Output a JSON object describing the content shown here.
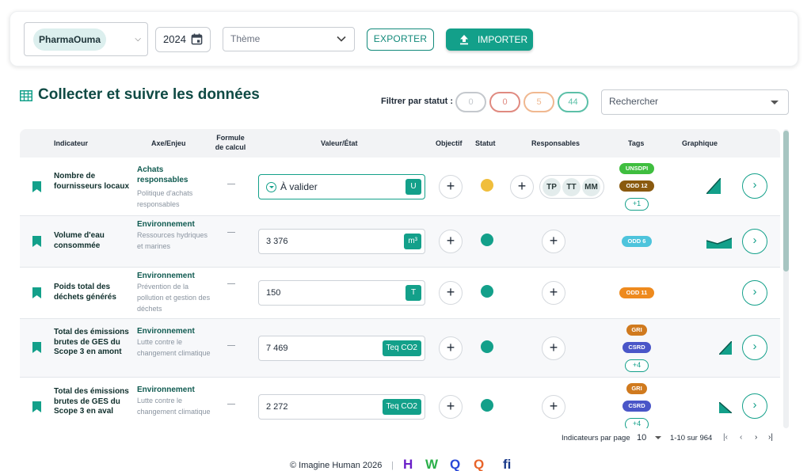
{
  "toolbar": {
    "company": "PharmaOuma",
    "year": "2024",
    "theme_placeholder": "Thème",
    "export_label": "EXPORTER",
    "import_label": "IMPORTER"
  },
  "header": {
    "title": "Collecter et suivre les données",
    "filter_label": "Filtrer par statut :",
    "status_counts": [
      {
        "value": "0",
        "color": "#c4c8cd"
      },
      {
        "value": "0",
        "color": "#e08a80"
      },
      {
        "value": "5",
        "color": "#f0b890"
      },
      {
        "value": "44",
        "color": "#5cc0a8"
      }
    ],
    "search_placeholder": "Rechercher"
  },
  "table": {
    "columns": {
      "indicator": "Indicateur",
      "axe": "Axe/Enjeu",
      "formula_line1": "Formule",
      "formula_line2": "de calcul",
      "value": "Valeur/État",
      "objective": "Objectif",
      "status": "Statut",
      "responsables": "Responsables",
      "tags": "Tags",
      "graph": "Graphique"
    },
    "rows": [
      {
        "name": "Nombre de fournisseurs locaux",
        "axe": "Achats responsables",
        "enjeu": "Politique d'achats responsables",
        "value": "À valider",
        "unit": "U",
        "status_color": "#f0be3c",
        "responsables": [
          "TP",
          "TT",
          "MM"
        ],
        "tags": [
          {
            "label": "UNSDPI",
            "color": "#3fbe3f"
          },
          {
            "label": "ODD 12",
            "color": "#8a5a0f"
          }
        ],
        "more_tags": "+1",
        "graph": "rising"
      },
      {
        "name": "Volume d'eau consommée",
        "axe": "Environnement",
        "enjeu": "Ressources hydriques et marines",
        "value": "3 376",
        "unit": "m³",
        "status_color": "#13a08a",
        "responsables": [],
        "tags": [
          {
            "label": "ODD 6",
            "color": "#4ec4dc"
          }
        ],
        "more_tags": "",
        "graph": "flat-rising"
      },
      {
        "name": "Poids total des déchets générés",
        "axe": "Environnement",
        "enjeu": "Prévention de la pollution et gestion des déchets",
        "value": "150",
        "unit": "T",
        "status_color": "#13a08a",
        "responsables": [],
        "tags": [
          {
            "label": "ODD 11",
            "color": "#ee8a1e"
          }
        ],
        "more_tags": "",
        "graph": "none"
      },
      {
        "name": "Total des émissions brutes de GES du Scope 3 en amont",
        "axe": "Environnement",
        "enjeu": "Lutte contre le changement climatique",
        "value": "7 469",
        "unit": "Teq CO2",
        "status_color": "#13a08a",
        "responsables": [],
        "tags": [
          {
            "label": "GRI",
            "color": "#d07a1e"
          },
          {
            "label": "CSRD",
            "color": "#4a56c8"
          }
        ],
        "more_tags": "+4",
        "graph": "rising"
      },
      {
        "name": "Total des émissions brutes de GES du Scope 3 en aval",
        "axe": "Environnement",
        "enjeu": "Lutte contre le changement climatique",
        "value": "2 272",
        "unit": "Teq CO2",
        "status_color": "#13a08a",
        "responsables": [],
        "tags": [
          {
            "label": "GRI",
            "color": "#d07a1e"
          },
          {
            "label": "CSRD",
            "color": "#4a56c8"
          }
        ],
        "more_tags": "+4",
        "graph": "falling"
      }
    ]
  },
  "pagination": {
    "per_page_label": "Indicateurs par page",
    "per_page": "10",
    "range": "1-10 sur 964"
  },
  "footer": {
    "copyright": "© Imagine Human 2026",
    "separator": "|",
    "logos": [
      {
        "letter": "H",
        "color": "#6a1fc8"
      },
      {
        "letter": "W",
        "color": "#2bb04a"
      },
      {
        "letter": "Q",
        "color": "#2a48d8"
      },
      {
        "letter": "Q",
        "color": "#e8642a"
      },
      {
        "letter": "fi",
        "color": "#1a3a8a"
      }
    ]
  }
}
